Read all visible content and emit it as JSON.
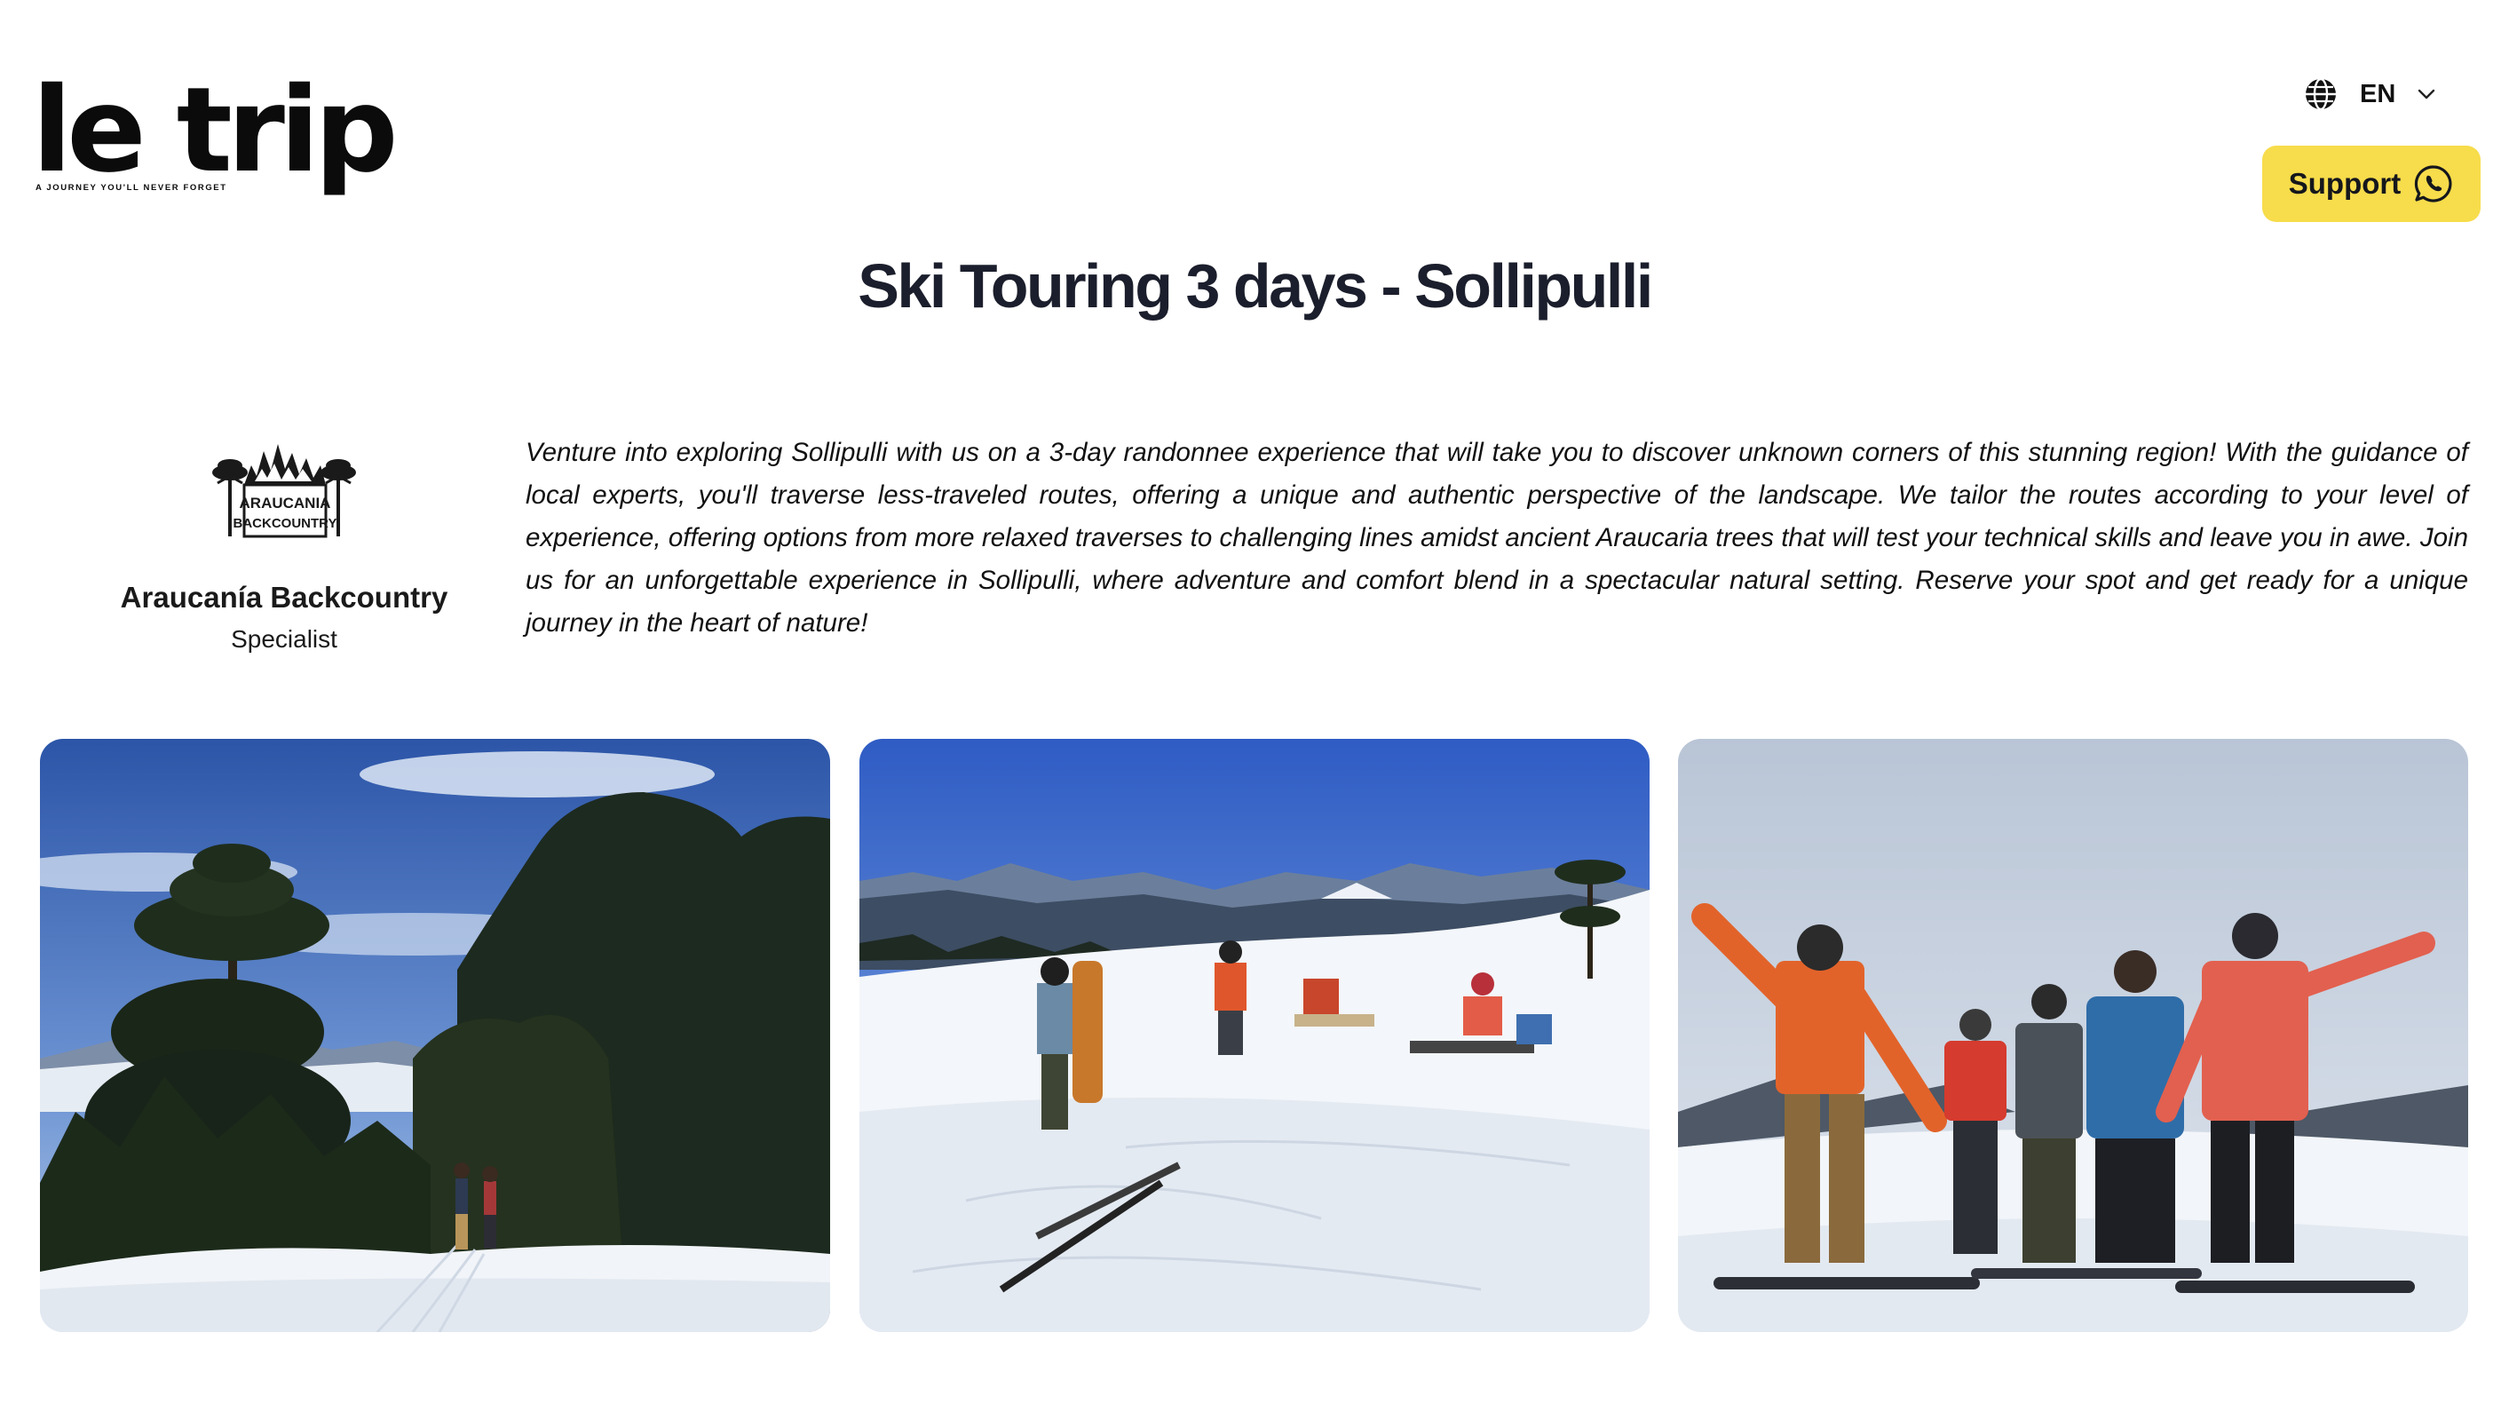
{
  "header": {
    "logo_text": "le trip",
    "logo_tagline": "A JOURNEY YOU'LL NEVER FORGET",
    "language": {
      "icon": "globe-icon",
      "code": "EN",
      "chevron": "chevron-down-icon"
    },
    "support": {
      "label": "Support",
      "icon": "whatsapp-icon",
      "background": "#f7dc4b"
    }
  },
  "trip": {
    "title": "Ski Touring 3 days - Sollipulli"
  },
  "specialist": {
    "logo_text_line1": "ARAUCANIA",
    "logo_text_line2": "BACKCOUNTRY",
    "name": "Araucanía Backcountry",
    "role": "Specialist"
  },
  "description": "Venture into exploring Sollipulli with us on a 3-day randonnee experience that will take you to discover unknown corners of this stunning region! With the guidance of local experts, you'll traverse less-traveled routes, offering a unique and authentic perspective of the landscape. We tailor the routes according to your level of experience, offering options from more relaxed traverses to challenging lines amidst ancient Araucaria trees that will test your technical skills and leave you in awe. Join us for an unforgettable experience in Sollipulli, where adventure and comfort blend in a spectacular natural setting. Reserve your spot and get ready for a unique journey in the heart of nature!",
  "gallery": [
    {
      "subject": "araucaria-forest-ski-tour"
    },
    {
      "subject": "group-resting-on-snow-slope"
    },
    {
      "subject": "group-posing-on-summit"
    }
  ]
}
